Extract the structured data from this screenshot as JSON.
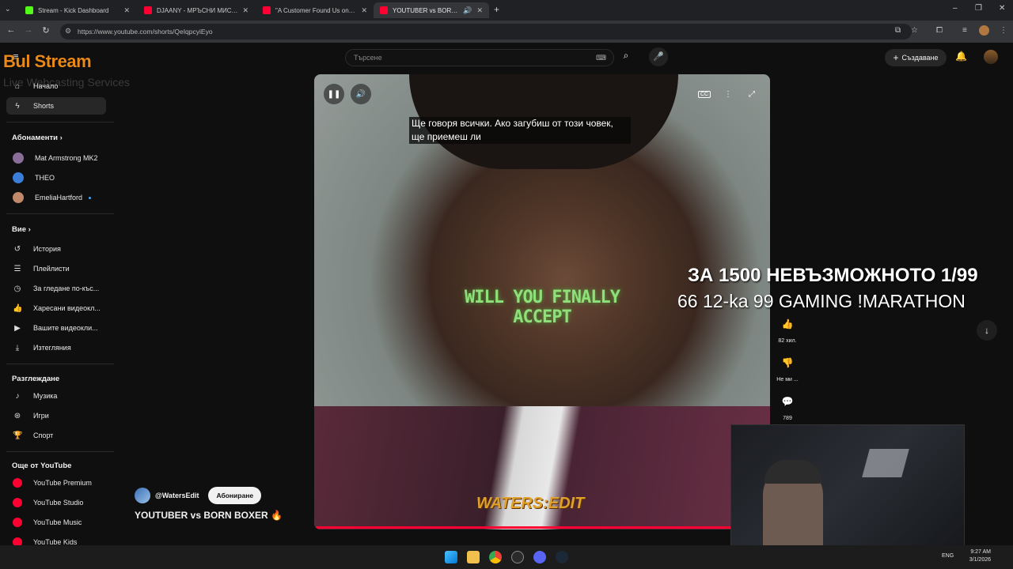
{
  "browser": {
    "tabs": [
      {
        "title": "Stream - Kick Dashboard",
        "favicon_color": "#53fc18"
      },
      {
        "title": "DJAANY - МРЪСНИ МИСЛИ (с",
        "favicon_color": "#ff0033"
      },
      {
        "title": "\"A Customer Found Us on Yelp",
        "favicon_color": "#ff0033"
      },
      {
        "title": "YOUTUBER vs BORN BOXER",
        "favicon_color": "#ff0033"
      }
    ],
    "url": "https://www.youtube.com/shorts/QeIqpcyiEyo"
  },
  "header": {
    "logo_text": "Bul Stream",
    "logo_sub": "Live Webcasting Services",
    "search_placeholder": "Търсене",
    "create_label": "Създаване"
  },
  "sidebar": {
    "main": [
      {
        "label": "Начало",
        "icon": "home-icon"
      },
      {
        "label": "Shorts",
        "icon": "shorts-icon"
      }
    ],
    "subs_title": "Абонаменти",
    "subscriptions": [
      {
        "label": "Mat Armstrong MK2",
        "color": "#8a6e9a"
      },
      {
        "label": "THEO",
        "color": "#3b7dd8"
      },
      {
        "label": "EmeliaHartford",
        "color": "#c08a6a"
      }
    ],
    "you_title": "Вие",
    "you": [
      {
        "label": "История",
        "icon": "history-icon"
      },
      {
        "label": "Плейлисти",
        "icon": "playlist-icon"
      },
      {
        "label": "За гледане по-къс...",
        "icon": "clock-icon"
      },
      {
        "label": "Харесани видеокл...",
        "icon": "like-icon"
      },
      {
        "label": "Вашите видеокли...",
        "icon": "video-icon"
      },
      {
        "label": "Изтегляния",
        "icon": "download-icon"
      }
    ],
    "explore_title": "Разглеждане",
    "explore": [
      {
        "label": "Музика",
        "icon": "music-icon"
      },
      {
        "label": "Игри",
        "icon": "gaming-icon"
      },
      {
        "label": "Спорт",
        "icon": "trophy-icon"
      }
    ],
    "more_title": "Още от YouTube",
    "more": [
      {
        "label": "YouTube Premium"
      },
      {
        "label": "YouTube Studio"
      },
      {
        "label": "YouTube Music"
      },
      {
        "label": "YouTube Kids"
      }
    ]
  },
  "video": {
    "caption": "Ще говоря всички.  Ако загубиш от този човек, ще приемеш ли",
    "overlay": "WILL YOU FINALLY ACCEPT",
    "watermark": "WATERS:EDIT",
    "progress": 0.92
  },
  "actions": {
    "likes": "82 хил.",
    "dislike": "Не ми ...",
    "comments": "789"
  },
  "channel": {
    "handle": "@WatersEdit",
    "subscribe_label": "Абониране",
    "title": "YOUTUBER vs BORN BOXER 🔥"
  },
  "stream_overlay": {
    "line1": "ЗА 1500 НЕВЪЗМОЖНОТО 1/99",
    "line2": "66 12-ka 99 GAMING !MARATHON"
  },
  "taskbar": {
    "lang": "ENG",
    "time": "9:27 AM",
    "date": "3/1/2026"
  }
}
